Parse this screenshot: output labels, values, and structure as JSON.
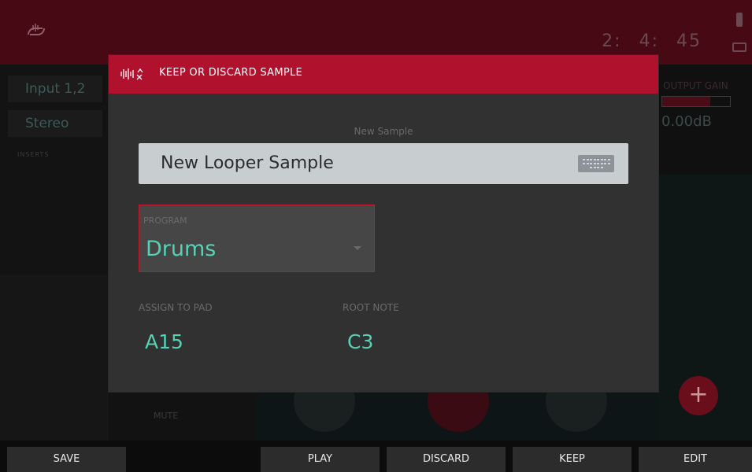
{
  "background": {
    "input_label": "Input 1,2",
    "mode_label": "Stereo",
    "inserts_label": "INSERTS",
    "counter": [
      "2:",
      "4:",
      "45"
    ],
    "output_gain_label": "OUTPUT GAIN",
    "output_gain_value": "0.00dB",
    "mute_label": "MUTE",
    "plus_glyph": "+"
  },
  "modal": {
    "title": "KEEP OR DISCARD SAMPLE",
    "icon": "sample-waveform-icon",
    "new_sample_label": "New Sample",
    "sample_name": "New Looper Sample",
    "program_label": "PROGRAM",
    "program_value": "Drums",
    "assign_to_pad_label": "ASSIGN TO PAD",
    "assign_to_pad_value": "A15",
    "root_note_label": "ROOT NOTE",
    "root_note_value": "C3"
  },
  "function_bar": {
    "f1": "SAVE",
    "f3": "PLAY",
    "f4": "DISCARD",
    "f5": "KEEP",
    "f6": "EDIT"
  },
  "colors": {
    "accent_red": "#b0122e",
    "value_teal": "#55d2b4",
    "field_bg": "#c8cdd0"
  }
}
